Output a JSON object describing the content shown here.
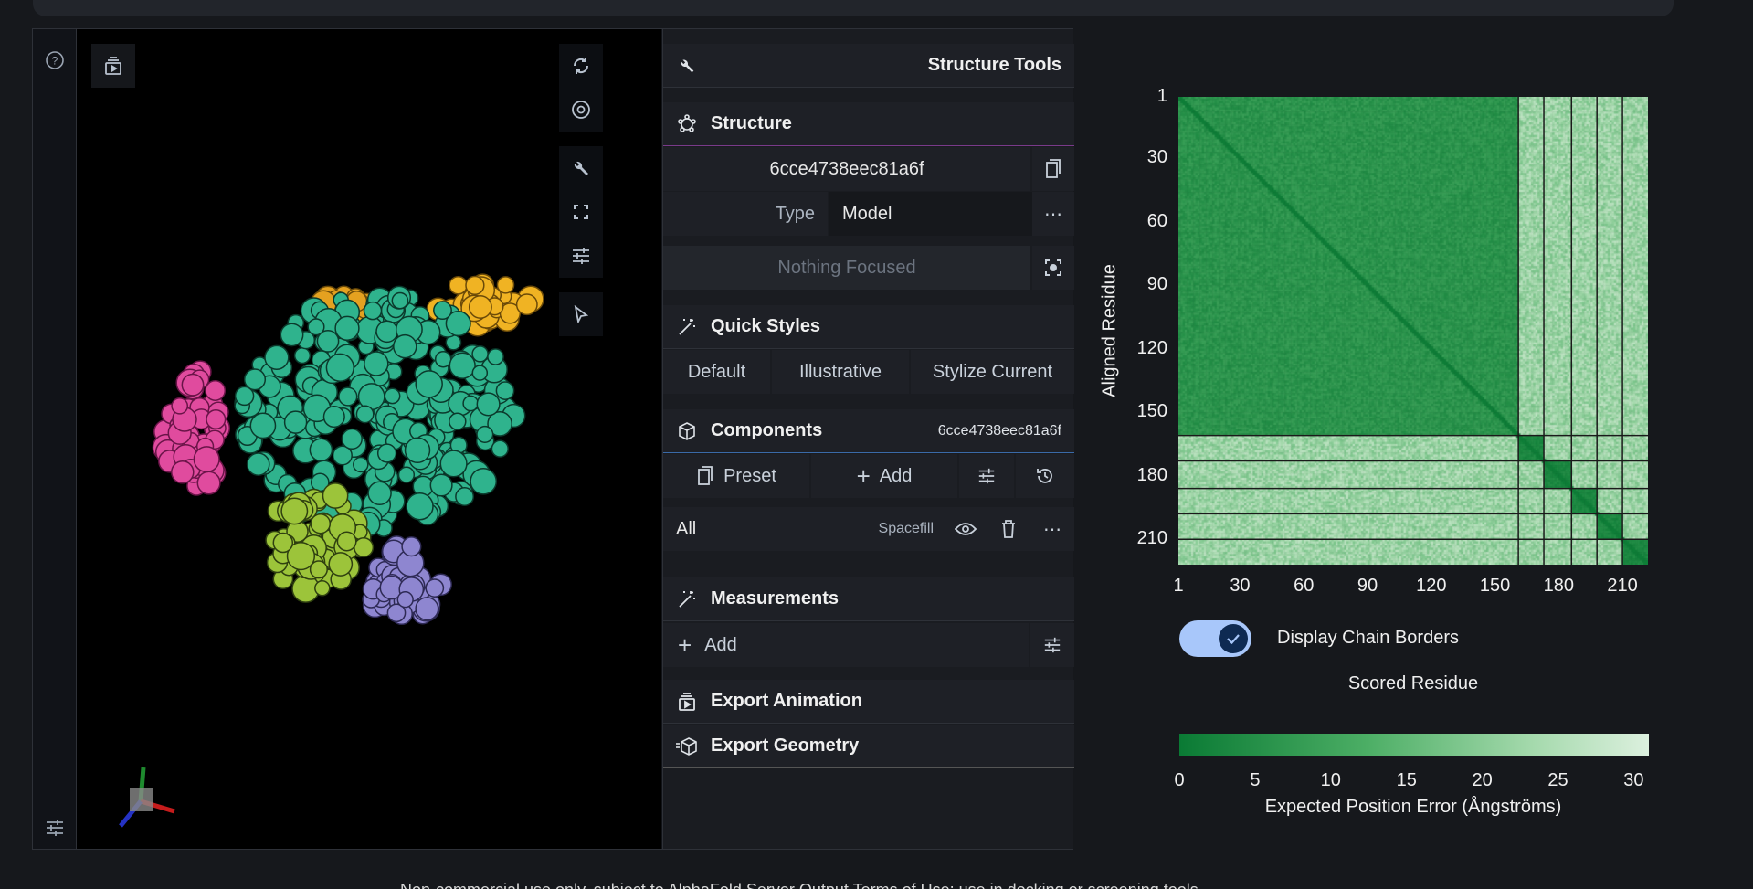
{
  "panel": {
    "title": "Structure Tools",
    "structure": {
      "title": "Structure",
      "id": "6cce4738eec81a6f",
      "type_label": "Type",
      "type_value": "Model",
      "focus": "Nothing Focused"
    },
    "quick_styles": {
      "title": "Quick Styles",
      "buttons": [
        "Default",
        "Illustrative",
        "Stylize Current"
      ]
    },
    "components": {
      "title": "Components",
      "id": "6cce4738eec81a6f",
      "preset": "Preset",
      "add": "Add",
      "item_label": "All",
      "item_repr": "Spacefill"
    },
    "measurements": {
      "title": "Measurements",
      "add": "Add"
    },
    "export_animation": "Export Animation",
    "export_geometry": "Export Geometry"
  },
  "pae": {
    "ylabel": "Aligned Residue",
    "yticks": [
      "1",
      "30",
      "60",
      "90",
      "120",
      "150",
      "180",
      "210"
    ],
    "xticks": [
      "1",
      "30",
      "60",
      "90",
      "120",
      "150",
      "180",
      "210"
    ],
    "toggle_label": "Display Chain Borders",
    "toggle_on": true,
    "xlabel": "Scored Residue",
    "colorbar_ticks": [
      "0",
      "5",
      "10",
      "15",
      "20",
      "25",
      "30"
    ],
    "colorbar_label": "Expected Position Error (Ångströms)",
    "chain_boundaries": [
      160,
      172,
      185,
      197,
      209
    ],
    "total_residues": 221
  },
  "colors": {
    "accent": "#a8c7fa",
    "pae_low": "#0a7a34",
    "pae_high": "#dcf0de"
  },
  "footer_text": "Non-commercial use only, subject to AlphaFold Server Output Terms of Use; use in docking or screening tools"
}
